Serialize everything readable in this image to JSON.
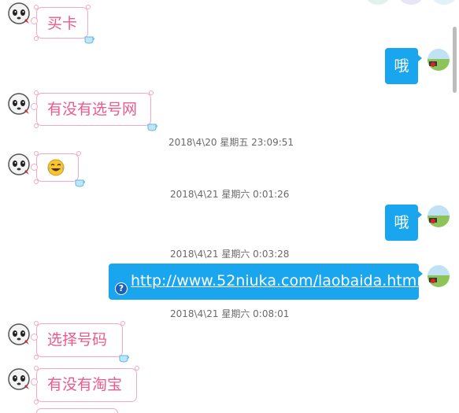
{
  "colors": {
    "incoming_border": "#f3a9c3",
    "incoming_text": "#ec5a8b",
    "outgoing_bubble": "#1aa6ee",
    "timestamp_text": "#6a6a6a",
    "scrollbar": "#bdbdbd"
  },
  "messages": {
    "in1": "买卡",
    "out1": "哦",
    "in2": "有没有选号网",
    "in3_emoji": "😂",
    "out2": "哦",
    "link": "http://www.52niuka.com/laobaida.html",
    "in4": "选择号码",
    "in5": "有没有淘宝"
  },
  "timestamps": {
    "t1": "2018\\4\\20 星期五 23:09:51",
    "t2": "2018\\4\\21 星期六 0:01:26",
    "t3": "2018\\4\\21 星期六 0:03:28",
    "t4": "2018\\4\\21 星期六 0:08:01"
  },
  "icons": {
    "contact_avatar": "panda-avatar-icon",
    "self_avatar": "landscape-avatar-icon",
    "bubble_decor": "teacup-icon",
    "link_type": "question-mark-icon"
  }
}
